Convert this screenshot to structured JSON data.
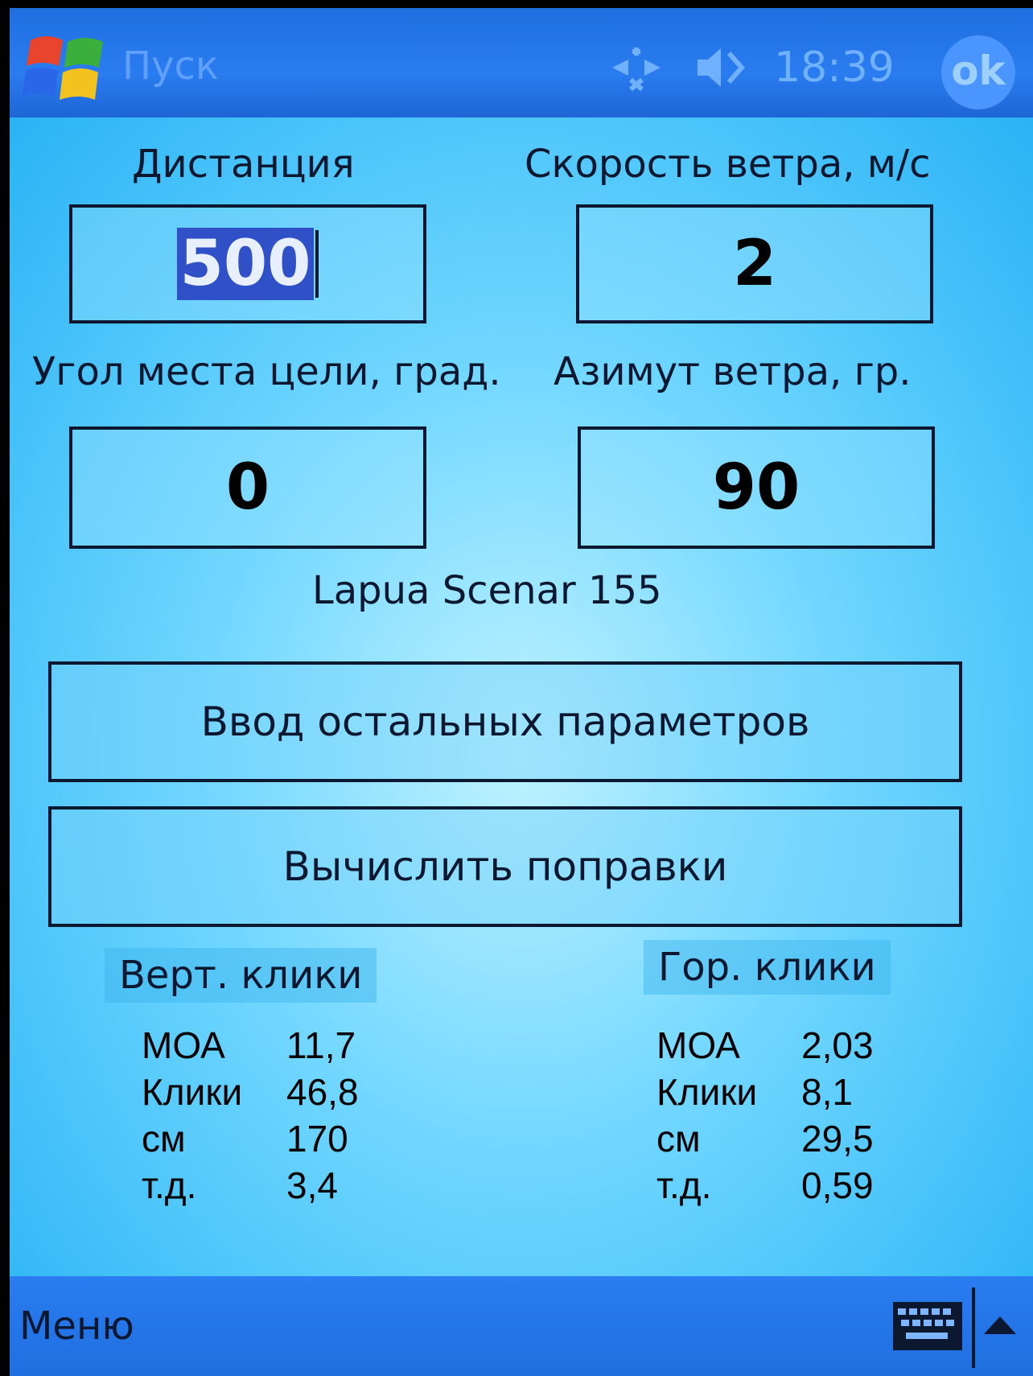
{
  "taskbar": {
    "start_label": "Пуск",
    "clock": "18:39",
    "ok_label": "ok"
  },
  "inputs": {
    "distance": {
      "label": "Дистанция",
      "value": "500"
    },
    "wind_speed": {
      "label": "Скорость ветра, м/с",
      "value": "2"
    },
    "target_angle": {
      "label": "Угол места цели, град.",
      "value": "0"
    },
    "wind_azimuth": {
      "label": "Азимут ветра, гр.",
      "value": "90"
    }
  },
  "bullet": "Lapua Scenar 155",
  "buttons": {
    "other_params": "Ввод остальных  параметров",
    "compute": "Вычислить поправки"
  },
  "results": {
    "vertical": {
      "title": "Верт. клики",
      "rows": [
        {
          "label": "МОА",
          "value": "11,7"
        },
        {
          "label": "Клики",
          "value": "46,8"
        },
        {
          "label": "см",
          "value": "170"
        },
        {
          "label": "т.д.",
          "value": "3,4"
        }
      ]
    },
    "horizontal": {
      "title": "Гор. клики",
      "rows": [
        {
          "label": "МОА",
          "value": "2,03"
        },
        {
          "label": "Клики",
          "value": "8,1"
        },
        {
          "label": "см",
          "value": "29,5"
        },
        {
          "label": "т.д.",
          "value": "0,59"
        }
      ]
    }
  },
  "bottom": {
    "menu_label": "Меню"
  },
  "colors": {
    "taskbar": "#1f6fe0",
    "background": "#6fd6ff",
    "text": "#0c1830",
    "selection": "#3050c8"
  }
}
